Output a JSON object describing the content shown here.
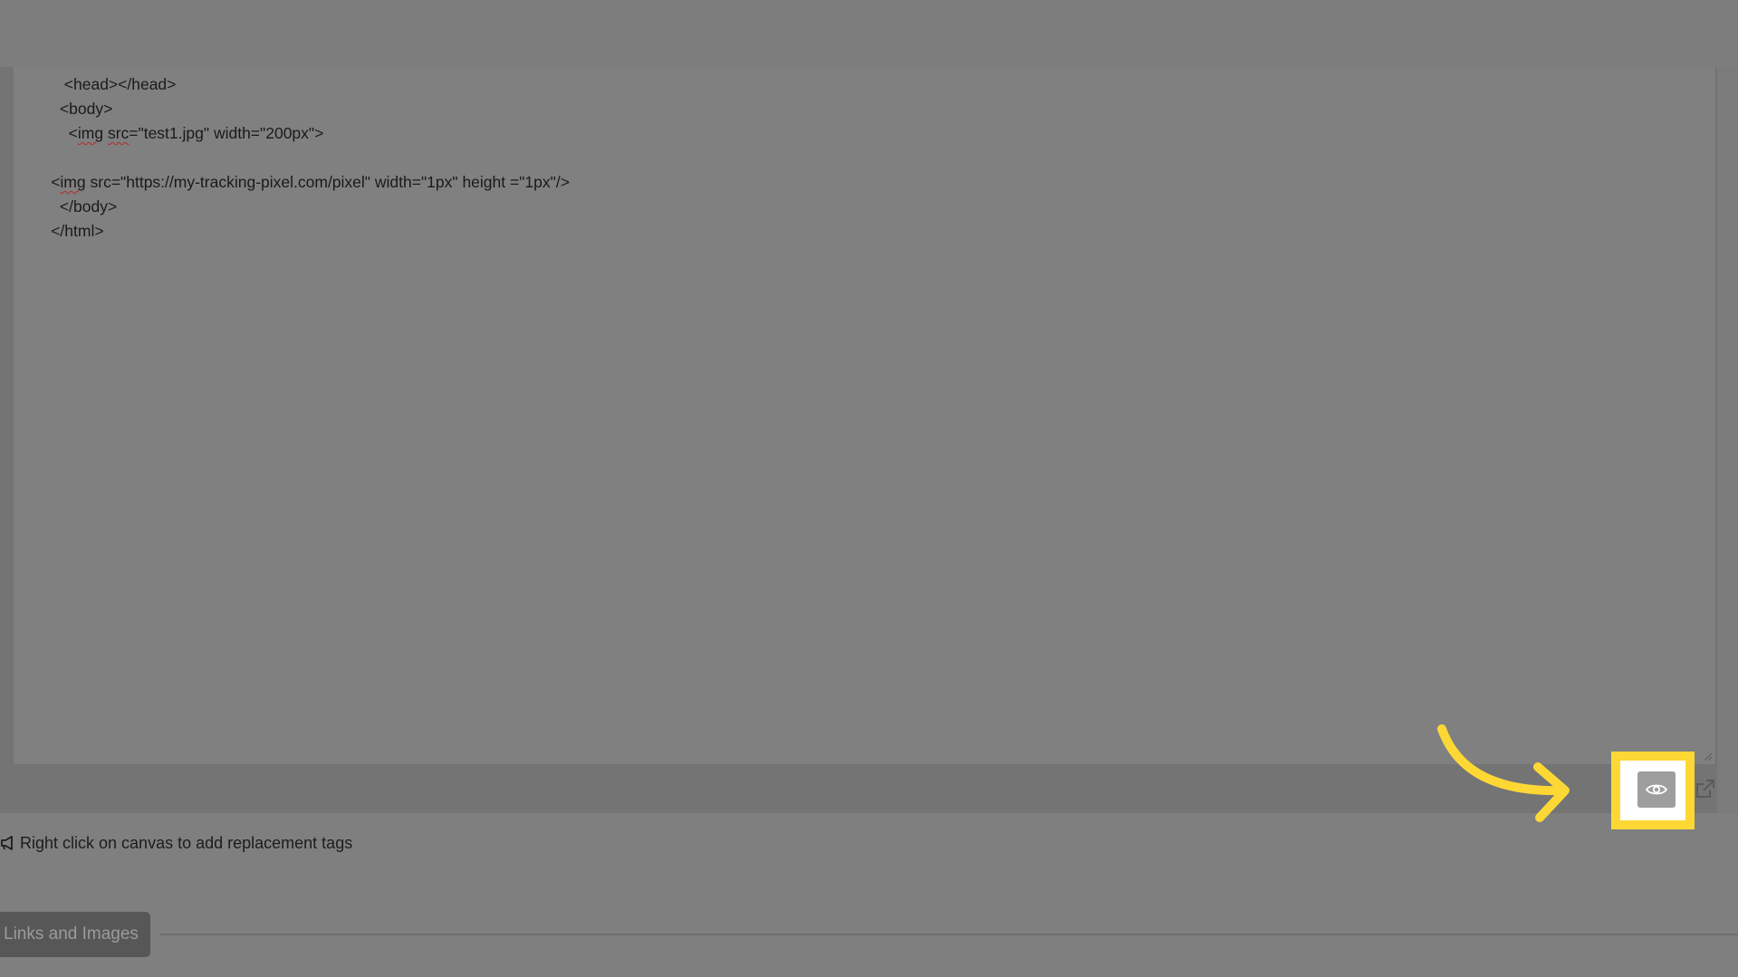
{
  "editor": {
    "lines": [
      {
        "indent": "   ",
        "pre": "",
        "squiggle": "",
        "mid": "",
        "squiggle2": "",
        "post": "<head></head>",
        "partial": true
      },
      {
        "indent": "  ",
        "pre": "<body>",
        "squiggle": "",
        "mid": "",
        "squiggle2": "",
        "post": ""
      },
      {
        "indent": "    ",
        "pre": "<",
        "squiggle": "img",
        "mid": " ",
        "squiggle2": "src",
        "post": "=\"test1.jpg\" width=\"200px\">"
      },
      {
        "indent": "",
        "pre": "",
        "squiggle": "",
        "mid": "",
        "squiggle2": "",
        "post": ""
      },
      {
        "indent": "",
        "pre": "<",
        "squiggle": "img",
        "mid": "",
        "squiggle2": "",
        "post": " src=\"https://my-tracking-pixel.com/pixel\" width=\"1px\" height =\"1px\"/>"
      },
      {
        "indent": "  ",
        "pre": "</body>",
        "squiggle": "",
        "mid": "",
        "squiggle2": "",
        "post": ""
      },
      {
        "indent": "",
        "pre": "</html>",
        "squiggle": "",
        "mid": "",
        "squiggle2": "",
        "post": ""
      }
    ]
  },
  "toolbar": {
    "preview_icon": "eye-icon",
    "external_icon": "external-link-icon"
  },
  "tip": {
    "icon": "megaphone-icon",
    "text": "Right click on canvas to add replacement tags"
  },
  "tabs": {
    "links_images_label": "Links and Images"
  },
  "colors": {
    "highlight": "#fdd835",
    "arrow": "#fdd835",
    "overlay_background": "#7f7f7f",
    "squiggle": "#b22a2a"
  }
}
